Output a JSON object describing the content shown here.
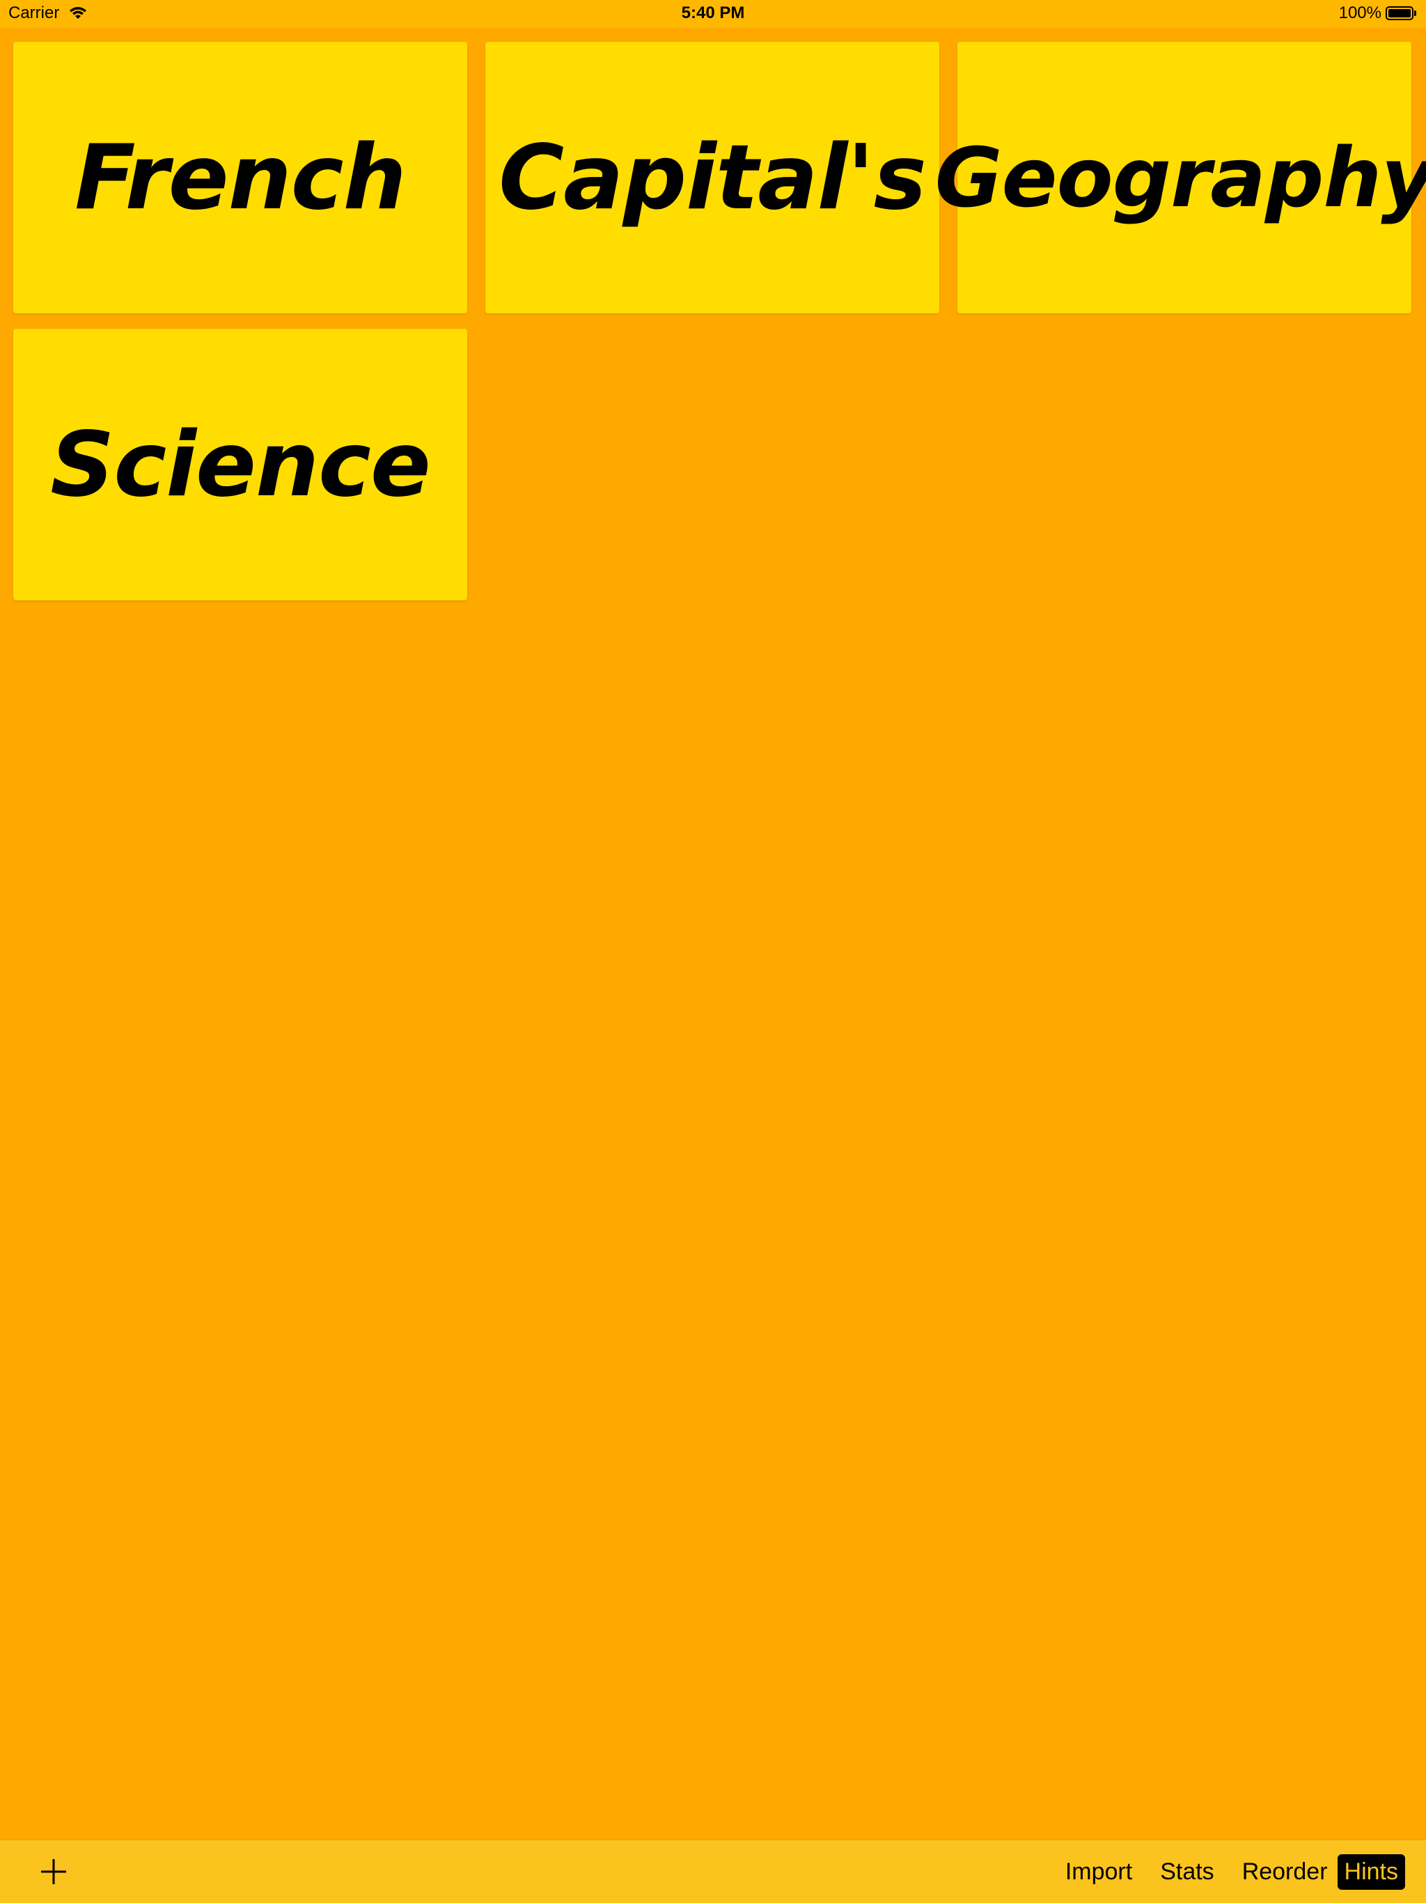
{
  "status_bar": {
    "carrier": "Carrier",
    "time": "5:40 PM",
    "battery": "100%"
  },
  "categories": [
    {
      "label": "French"
    },
    {
      "label": "Capital's"
    },
    {
      "label": "Geography"
    },
    {
      "label": "Science"
    }
  ],
  "toolbar": {
    "add_icon": "plus-icon",
    "items": [
      {
        "label": "Import"
      },
      {
        "label": "Stats"
      },
      {
        "label": "Reorder"
      },
      {
        "label": "Hints",
        "active": true
      }
    ]
  },
  "colors": {
    "background": "#FFA800",
    "tile": "#FFDD00",
    "toolbar": "#FBC31E",
    "status_bar": "#FFB800"
  }
}
